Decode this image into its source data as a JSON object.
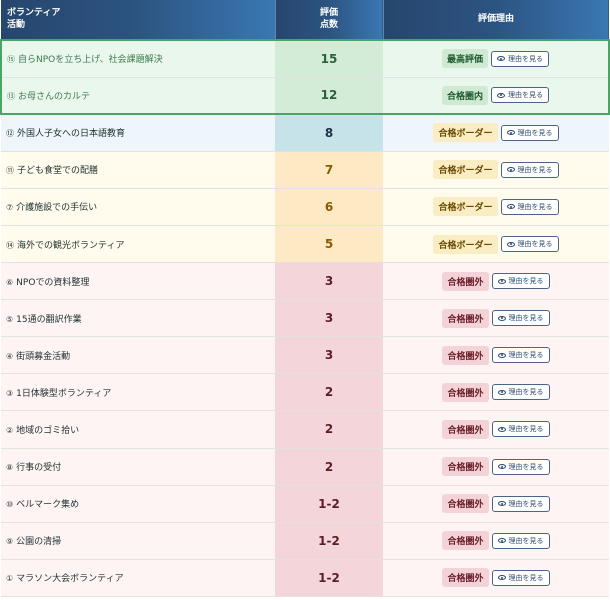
{
  "header": {
    "activity_line1": "ボランティア",
    "activity_line2": "活動",
    "score_line1": "評価",
    "score_line2": "点数",
    "reason": "評価理由"
  },
  "rows": [
    {
      "num": "⑮",
      "name": "自らNPOを立ち上げ、社会課題解決",
      "score": "15",
      "badge": "最高評価",
      "button": "理由を見る",
      "tier": "green"
    },
    {
      "num": "⑬",
      "name": "お母さんのカルテ",
      "score": "12",
      "badge": "合格圏内",
      "button": "理由を見る",
      "tier": "green"
    },
    {
      "num": "⑫",
      "name": "外国人子女への日本語教育",
      "score": "8",
      "badge": "合格ボーダー",
      "button": "理由を見る",
      "tier": "blue"
    },
    {
      "num": "⑪",
      "name": "子ども食堂での配膳",
      "score": "7",
      "badge": "合格ボーダー",
      "button": "理由を見る",
      "tier": "yellow"
    },
    {
      "num": "⑦",
      "name": "介護施設での手伝い",
      "score": "6",
      "badge": "合格ボーダー",
      "button": "理由を見る",
      "tier": "yellow"
    },
    {
      "num": "⑭",
      "name": "海外での観光ボランティア",
      "score": "5",
      "badge": "合格ボーダー",
      "button": "理由を見る",
      "tier": "yellow"
    },
    {
      "num": "⑥",
      "name": "NPOでの資料整理",
      "score": "3",
      "badge": "合格圏外",
      "button": "理由を見る",
      "tier": "red"
    },
    {
      "num": "⑤",
      "name": "15通の翻訳作業",
      "score": "3",
      "badge": "合格圏外",
      "button": "理由を見る",
      "tier": "red"
    },
    {
      "num": "④",
      "name": "街頭募金活動",
      "score": "3",
      "badge": "合格圏外",
      "button": "理由を見る",
      "tier": "red"
    },
    {
      "num": "③",
      "name": "1日体験型ボランティア",
      "score": "2",
      "badge": "合格圏外",
      "button": "理由を見る",
      "tier": "red"
    },
    {
      "num": "②",
      "name": "地域のゴミ拾い",
      "score": "2",
      "badge": "合格圏外",
      "button": "理由を見る",
      "tier": "red"
    },
    {
      "num": "⑧",
      "name": "行事の受付",
      "score": "2",
      "badge": "合格圏外",
      "button": "理由を見る",
      "tier": "red"
    },
    {
      "num": "⑩",
      "name": "ベルマーク集め",
      "score": "1-2",
      "badge": "合格圏外",
      "button": "理由を見る",
      "tier": "red"
    },
    {
      "num": "⑨",
      "name": "公園の清掃",
      "score": "1-2",
      "badge": "合格圏外",
      "button": "理由を見る",
      "tier": "red"
    },
    {
      "num": "①",
      "name": "マラソン大会ボランティア",
      "score": "1-2",
      "badge": "合格圏外",
      "button": "理由を見る",
      "tier": "red"
    }
  ],
  "icons": {
    "button_icon": "eye-icon"
  },
  "colors": {
    "header": "#2c5481",
    "top_tier": "#4aa565",
    "border_tier": "#faecc3",
    "out_tier": "#f3d3d8"
  }
}
